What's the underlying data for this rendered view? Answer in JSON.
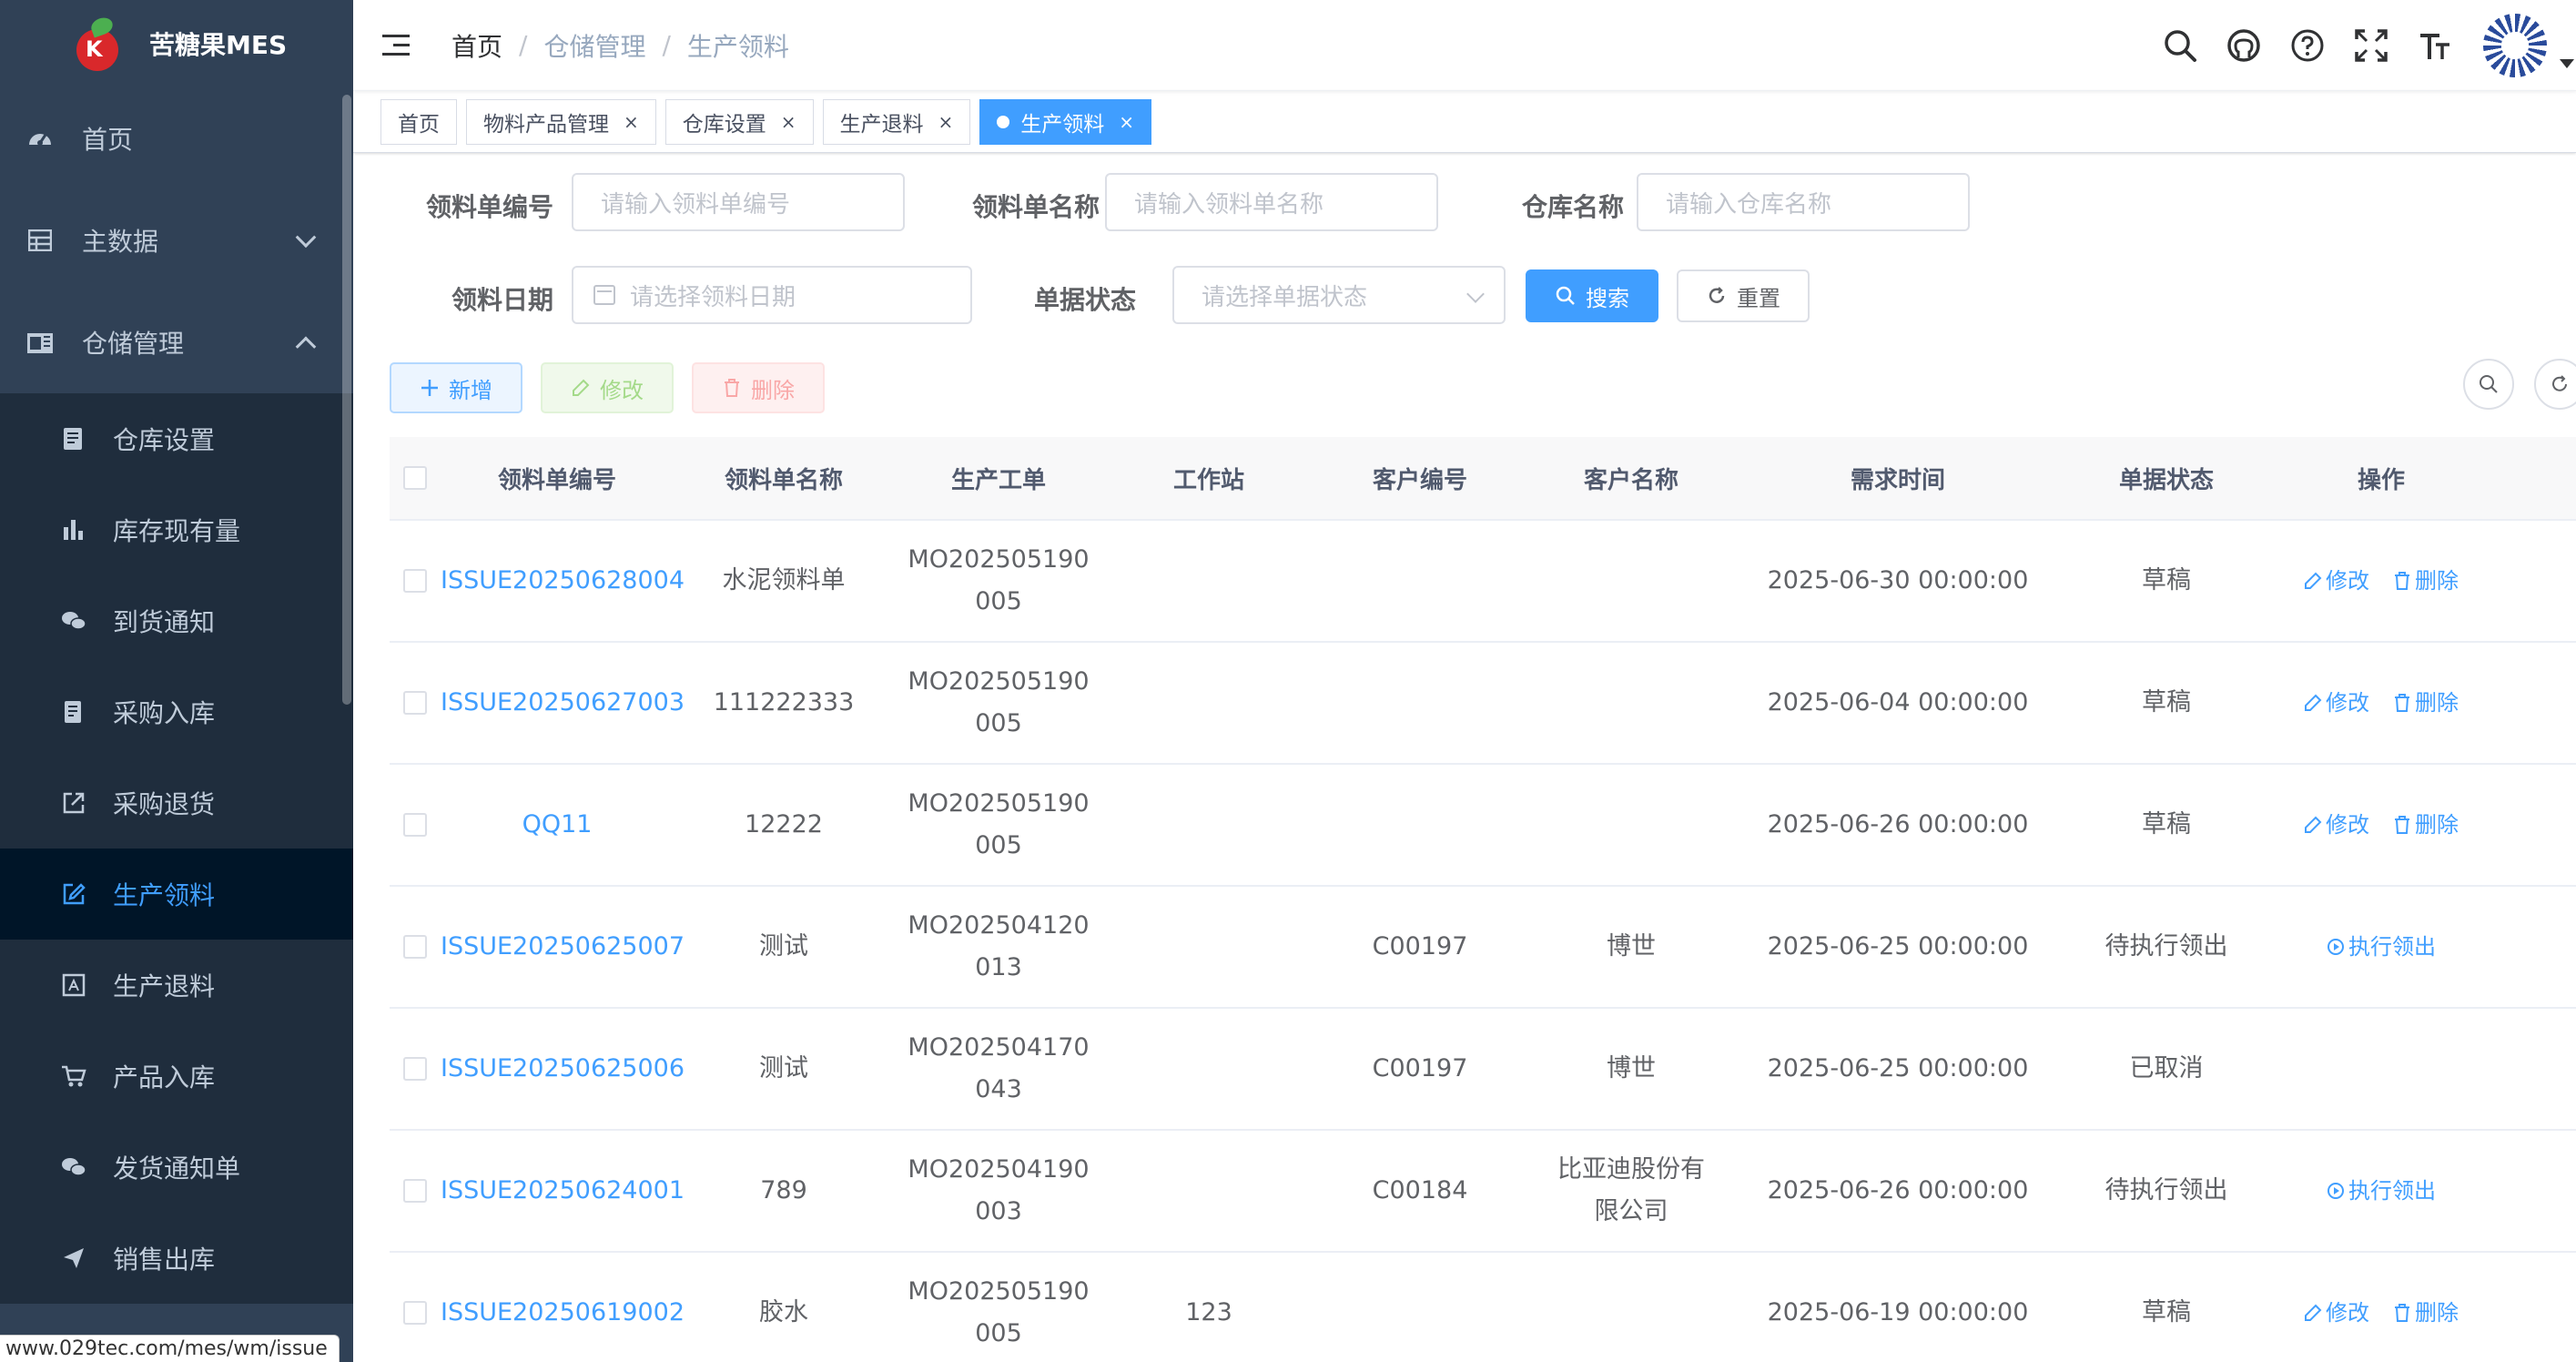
{
  "app": {
    "title": "苦糖果MES",
    "logo_letter": "K"
  },
  "sidebar": {
    "items": [
      {
        "label": "首页",
        "icon": "dashboard-icon"
      },
      {
        "label": "主数据",
        "icon": "table-icon"
      },
      {
        "label": "仓储管理",
        "icon": "warehouse-icon"
      }
    ],
    "submenu": [
      {
        "label": "仓库设置",
        "icon": "server-icon"
      },
      {
        "label": "库存现有量",
        "icon": "bar-chart-icon"
      },
      {
        "label": "到货通知",
        "icon": "wechat-icon"
      },
      {
        "label": "采购入库",
        "icon": "document-icon"
      },
      {
        "label": "采购退货",
        "icon": "external-link-icon"
      },
      {
        "label": "生产领料",
        "icon": "edit-icon"
      },
      {
        "label": "生产退料",
        "icon": "return-icon"
      },
      {
        "label": "产品入库",
        "icon": "cart-icon"
      },
      {
        "label": "发货通知单",
        "icon": "wechat-icon"
      },
      {
        "label": "销售出库",
        "icon": "send-icon"
      }
    ],
    "status_url": "www.029tec.com/mes/wm/issue"
  },
  "breadcrumb": {
    "home": "首页",
    "level1": "仓储管理",
    "level2": "生产领料",
    "sep": "/"
  },
  "tags": [
    {
      "label": "首页",
      "closable": false
    },
    {
      "label": "物料产品管理",
      "closable": true
    },
    {
      "label": "仓库设置",
      "closable": true
    },
    {
      "label": "生产退料",
      "closable": true
    },
    {
      "label": "生产领料",
      "closable": true,
      "active": true
    }
  ],
  "tag_close": "×",
  "form": {
    "code_label": "领料单编号",
    "code_placeholder": "请输入领料单编号",
    "name_label": "领料单名称",
    "name_placeholder": "请输入领料单名称",
    "warehouse_label": "仓库名称",
    "warehouse_placeholder": "请输入仓库名称",
    "date_label": "领料日期",
    "date_placeholder": "请选择领料日期",
    "status_label": "单据状态",
    "status_placeholder": "请选择单据状态",
    "search_label": "搜索",
    "reset_label": "重置"
  },
  "toolbar": {
    "add_label": "新增",
    "edit_label": "修改",
    "delete_label": "删除"
  },
  "table": {
    "headers": [
      "领料单编号",
      "领料单名称",
      "生产工单",
      "工作站",
      "客户编号",
      "客户名称",
      "需求时间",
      "单据状态",
      "操作"
    ],
    "rows": [
      {
        "code": "ISSUE20250628004",
        "name": "水泥领料单",
        "wo1": "MO202505190",
        "wo2": "005",
        "station": "",
        "cust_code": "",
        "cust_name1": "",
        "cust_name2": "",
        "time": "2025-06-30 00:00:00",
        "status": "草稿",
        "ops": "edit"
      },
      {
        "code": "ISSUE20250627003",
        "name": "111222333",
        "wo1": "MO202505190",
        "wo2": "005",
        "station": "",
        "cust_code": "",
        "cust_name1": "",
        "cust_name2": "",
        "time": "2025-06-04 00:00:00",
        "status": "草稿",
        "ops": "edit"
      },
      {
        "code": "QQ11",
        "name": "12222",
        "wo1": "MO202505190",
        "wo2": "005",
        "station": "",
        "cust_code": "",
        "cust_name1": "",
        "cust_name2": "",
        "time": "2025-06-26 00:00:00",
        "status": "草稿",
        "ops": "edit"
      },
      {
        "code": "ISSUE20250625007",
        "name": "测试",
        "wo1": "MO202504120",
        "wo2": "013",
        "station": "",
        "cust_code": "C00197",
        "cust_name1": "博世",
        "cust_name2": "",
        "time": "2025-06-25 00:00:00",
        "status": "待执行领出",
        "ops": "exec"
      },
      {
        "code": "ISSUE20250625006",
        "name": "测试",
        "wo1": "MO202504170",
        "wo2": "043",
        "station": "",
        "cust_code": "C00197",
        "cust_name1": "博世",
        "cust_name2": "",
        "time": "2025-06-25 00:00:00",
        "status": "已取消",
        "ops": "none"
      },
      {
        "code": "ISSUE20250624001",
        "name": "789",
        "wo1": "MO202504190",
        "wo2": "003",
        "station": "",
        "cust_code": "C00184",
        "cust_name1": "比亚迪股份有",
        "cust_name2": "限公司",
        "time": "2025-06-26 00:00:00",
        "status": "待执行领出",
        "ops": "exec"
      },
      {
        "code": "ISSUE20250619002",
        "name": "胶水",
        "wo1": "MO202505190",
        "wo2": "005",
        "station": "123",
        "cust_code": "",
        "cust_name1": "",
        "cust_name2": "",
        "time": "2025-06-19 00:00:00",
        "status": "草稿",
        "ops": "edit"
      }
    ],
    "op_edit": "修改",
    "op_delete": "删除",
    "op_exec": "执行领出"
  },
  "colors": {
    "primary": "#409eff",
    "sidebar_bg": "#304156",
    "submenu_bg": "#1f2d3d",
    "active_bg": "#001528"
  }
}
